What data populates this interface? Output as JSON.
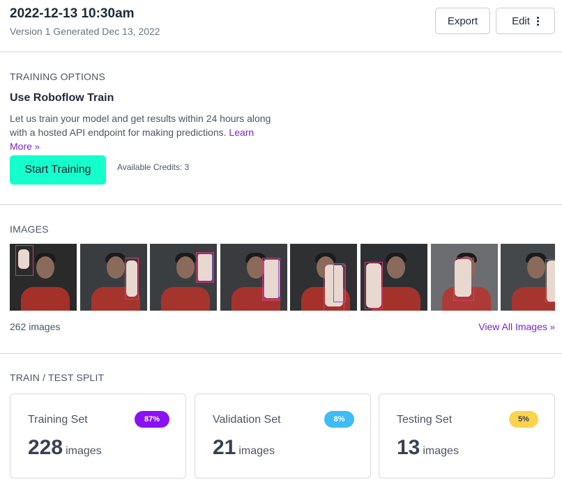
{
  "header": {
    "title": "2022-12-13 10:30am",
    "subtitle": "Version 1 Generated Dec 13, 2022",
    "export_label": "Export",
    "edit_label": "Edit"
  },
  "training": {
    "section_label": "TRAINING OPTIONS",
    "title": "Use Roboflow Train",
    "description": "Let us train your model and get results within 24 hours along with a hosted API endpoint for making predictions.",
    "learn_more": "Learn More",
    "start_button": "Start Training",
    "credits": "Available Credits: 3"
  },
  "images": {
    "section_label": "IMAGES",
    "count": "262 images",
    "view_all": "View All Images",
    "thumbnails": [
      {
        "name": "image-thumbnail-1",
        "bg": "#2a2a2a"
      },
      {
        "name": "image-thumbnail-2",
        "bg": "#3a3d40"
      },
      {
        "name": "image-thumbnail-3",
        "bg": "#3b3e41"
      },
      {
        "name": "image-thumbnail-4",
        "bg": "#393b3e"
      },
      {
        "name": "image-thumbnail-5",
        "bg": "#2e3032"
      },
      {
        "name": "image-thumbnail-6",
        "bg": "#2d3033"
      },
      {
        "name": "image-thumbnail-7",
        "bg": "#6b6d70"
      },
      {
        "name": "image-thumbnail-8",
        "bg": "#44484b"
      }
    ]
  },
  "split": {
    "section_label": "TRAIN / TEST SPLIT",
    "unit": "images",
    "cards": [
      {
        "label": "Training Set",
        "percent": "87%",
        "count": "228",
        "badge_bg": "#8b11f5",
        "badge_fg": "#ffffff"
      },
      {
        "label": "Validation Set",
        "percent": "8%",
        "count": "21",
        "badge_bg": "#3ebcf3",
        "badge_fg": "#ffffff"
      },
      {
        "label": "Testing Set",
        "percent": "5%",
        "count": "13",
        "badge_bg": "#fcd34d",
        "badge_fg": "#374151"
      }
    ]
  }
}
